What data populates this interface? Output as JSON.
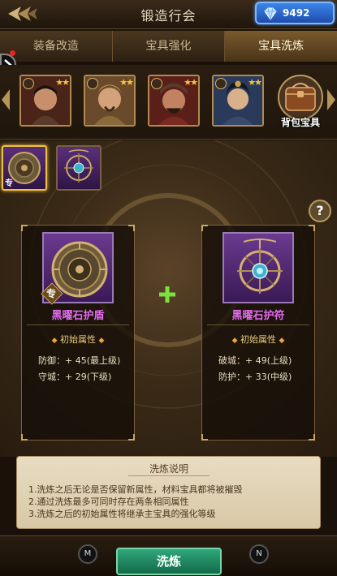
{
  "header": {
    "title": "锻造行会",
    "currency_amount": "9492",
    "currency_icon": "diamond-icon"
  },
  "tabs": [
    {
      "label": "装备改造",
      "active": false
    },
    {
      "label": "宝具强化",
      "active": false
    },
    {
      "label": "宝具洗炼",
      "active": true
    }
  ],
  "heroes": [
    {
      "name": "hero-1",
      "stars": "★★",
      "palette": "#6b3a2a"
    },
    {
      "name": "hero-2",
      "stars": "★★",
      "palette": "#8a6a3a"
    },
    {
      "name": "hero-3",
      "stars": "★★",
      "palette": "#7a2a22"
    },
    {
      "name": "hero-4",
      "stars": "★★",
      "palette": "#3a4a6a"
    }
  ],
  "bag_button": {
    "label": "背包宝具"
  },
  "main_item": {
    "name": "黑曜石护盾",
    "tag": "专",
    "attr_title": "初始属性",
    "attrs": [
      "防御：+ 45(最上级)",
      "守城：+ 29(下级)"
    ]
  },
  "material_item": {
    "name": "黑曜石护符",
    "attr_title": "初始属性",
    "attrs": [
      "破城：+ 49(上级)",
      "防护：+ 33(中级)"
    ]
  },
  "explanation": {
    "title": "洗炼说明",
    "lines": [
      "1.洗炼之后无论是否保留新属性，材料宝具都将被摧毁",
      "2.通过洗炼最多可同时存在两条相同属性",
      "3.洗炼之后的初始属性将继承主宝具的强化等级"
    ]
  },
  "bottom": {
    "wash_label": "洗炼",
    "m_label": "M",
    "n_label": "N"
  },
  "colors": {
    "accent_gold": "#d9b56a",
    "item_name_purple": "#e36cf0",
    "wash_green": "#2fa87a"
  }
}
